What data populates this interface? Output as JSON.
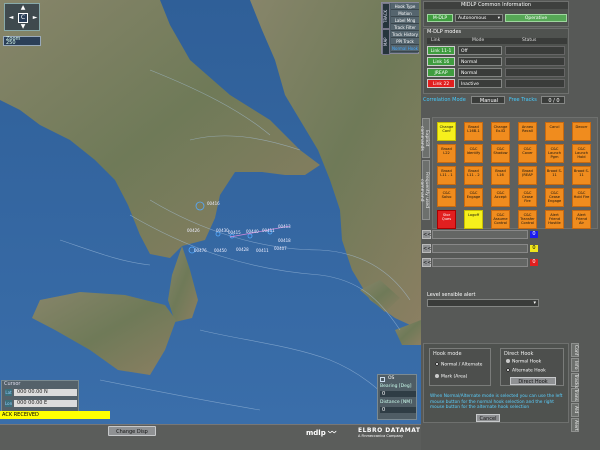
{
  "map": {
    "nav_center": "C",
    "nav_arrows": [
      "▲",
      "▼",
      "◄",
      "►"
    ],
    "zoom_label": "Zoom",
    "zoom_value": "250",
    "side_tabs": [
      "TRACK",
      "MAP"
    ],
    "menu_items": [
      "Hook Type",
      "Motion",
      "Label Mng",
      "Track Filter",
      "Track History",
      "PPI Track",
      "Normal Hook"
    ],
    "track_labels": [
      "00416",
      "00426",
      "00430",
      "00415",
      "00440",
      "00411",
      "00413",
      "00418",
      "00476",
      "00450",
      "00428",
      "00411",
      "00407"
    ],
    "cursor": {
      "title": "Cursor",
      "lat_label": "Lat",
      "lat_value": "000 00.00 N",
      "lon_label": "Lon",
      "lon_value": "000 00.00 E"
    },
    "os": {
      "title": "OS",
      "bearing_label": "Bearing [Deg]",
      "bearing_value": "0",
      "distance_label": "Distance [NM]",
      "distance_value": "0"
    },
    "ack_text": "ACK RECEIVED"
  },
  "bottom": {
    "change_btn": "Change Disp",
    "logo_mdlp": "mdlp",
    "logo_company": "ELBRO DATAMAT",
    "logo_sub": "A Finmeccanica Company"
  },
  "panel": {
    "common_title": "MIDLP Common Information",
    "mode_btn": "M-DLP",
    "mode_select": "Autonomous",
    "status_btn": "Operative",
    "modes_title": "M-DLP modes",
    "table_headers": [
      "Link",
      "Mode",
      "Status"
    ],
    "links": [
      {
        "name": "Link 11-1",
        "mode": "Off",
        "status": "",
        "color": "#3f9c3f"
      },
      {
        "name": "Link 16",
        "mode": "Normal",
        "status": "",
        "color": "#3f9c3f"
      },
      {
        "name": "JREAP",
        "mode": "Normal",
        "status": "",
        "color": "#3f9c3f"
      },
      {
        "name": "Link 22",
        "mode": "Inactive",
        "status": "",
        "color": "#e21f1f"
      }
    ],
    "correlation_label": "Correlation Mode",
    "correlation_value": "Manual",
    "free_tracks_label": "Free Tracks",
    "free_tracks_value": "0 / 0",
    "cmd_tabs": [
      "Frequently used command",
      "Explicit commands"
    ],
    "commands": [
      {
        "label": "Change Conf",
        "color": "yellow"
      },
      {
        "label": "Broad L16B-1",
        "color": "orange"
      },
      {
        "label": "Change Ex.ID",
        "color": "orange"
      },
      {
        "label": "Annex Recall",
        "color": "orange"
      },
      {
        "label": "Cancl",
        "color": "orange"
      },
      {
        "label": "Decorr",
        "color": "orange"
      },
      {
        "label": "Broad L22",
        "color": "orange"
      },
      {
        "label": "C&C Identify",
        "color": "orange"
      },
      {
        "label": "C&C Shadow",
        "color": "orange"
      },
      {
        "label": "C&C Cover",
        "color": "orange"
      },
      {
        "label": "C&C Launch Pgm",
        "color": "orange"
      },
      {
        "label": "C&C Launch Hold",
        "color": "orange"
      },
      {
        "label": "Broad L11 - 1",
        "color": "orange"
      },
      {
        "label": "Broad L11 - 2",
        "color": "orange"
      },
      {
        "label": "Broad L16",
        "color": "orange"
      },
      {
        "label": "Broad JREAP",
        "color": "orange"
      },
      {
        "label": "Broad S-11",
        "color": "orange"
      },
      {
        "label": "Broad S-11",
        "color": "orange"
      },
      {
        "label": "C&C Salvo",
        "color": "orange"
      },
      {
        "label": "C&C Engage",
        "color": "orange"
      },
      {
        "label": "C&C Accept",
        "color": "orange"
      },
      {
        "label": "C&C Cease Fire",
        "color": "orange"
      },
      {
        "label": "C&C Cease Engage",
        "color": "orange"
      },
      {
        "label": "C&C Hold Fire",
        "color": "orange"
      },
      {
        "label": "Stor Ques",
        "color": "red"
      },
      {
        "label": "Logoff",
        "color": "yellow"
      },
      {
        "label": "C&C Assume Control",
        "color": "orange"
      },
      {
        "label": "C&C Transfer Control",
        "color": "orange"
      },
      {
        "label": "Alert Friend Hostile",
        "color": "orange"
      },
      {
        "label": "Alert Friend Air",
        "color": "orange"
      }
    ],
    "msg_rows": [
      {
        "btn": "<<",
        "count": "0",
        "color": "#1c1cf0"
      },
      {
        "btn": "<<",
        "count": "0",
        "color": "#f0e61c"
      },
      {
        "btn": "<<",
        "count": "0",
        "color": "#e21f1f"
      }
    ],
    "alert_label": "Level sensible alert",
    "hook_mode_title": "Hook mode",
    "hook_mode_options": [
      "Normal / Alternate",
      "Mark (Area)"
    ],
    "direct_hook_title": "Direct Hook",
    "direct_hook_options": [
      "Normal Hook",
      "Alternate Hook"
    ],
    "direct_hook_btn": "Direct Hook",
    "hint_text": "When Normal/Alternate mode is selected you can use the left mouse button for the normal hook selection and the right mouse button for the alternate hook selection",
    "cancel_btn": "Cancel",
    "side_tabs": [
      "Conf",
      "Info",
      "Tracks",
      "Trans",
      "Ald",
      "Alert"
    ]
  }
}
